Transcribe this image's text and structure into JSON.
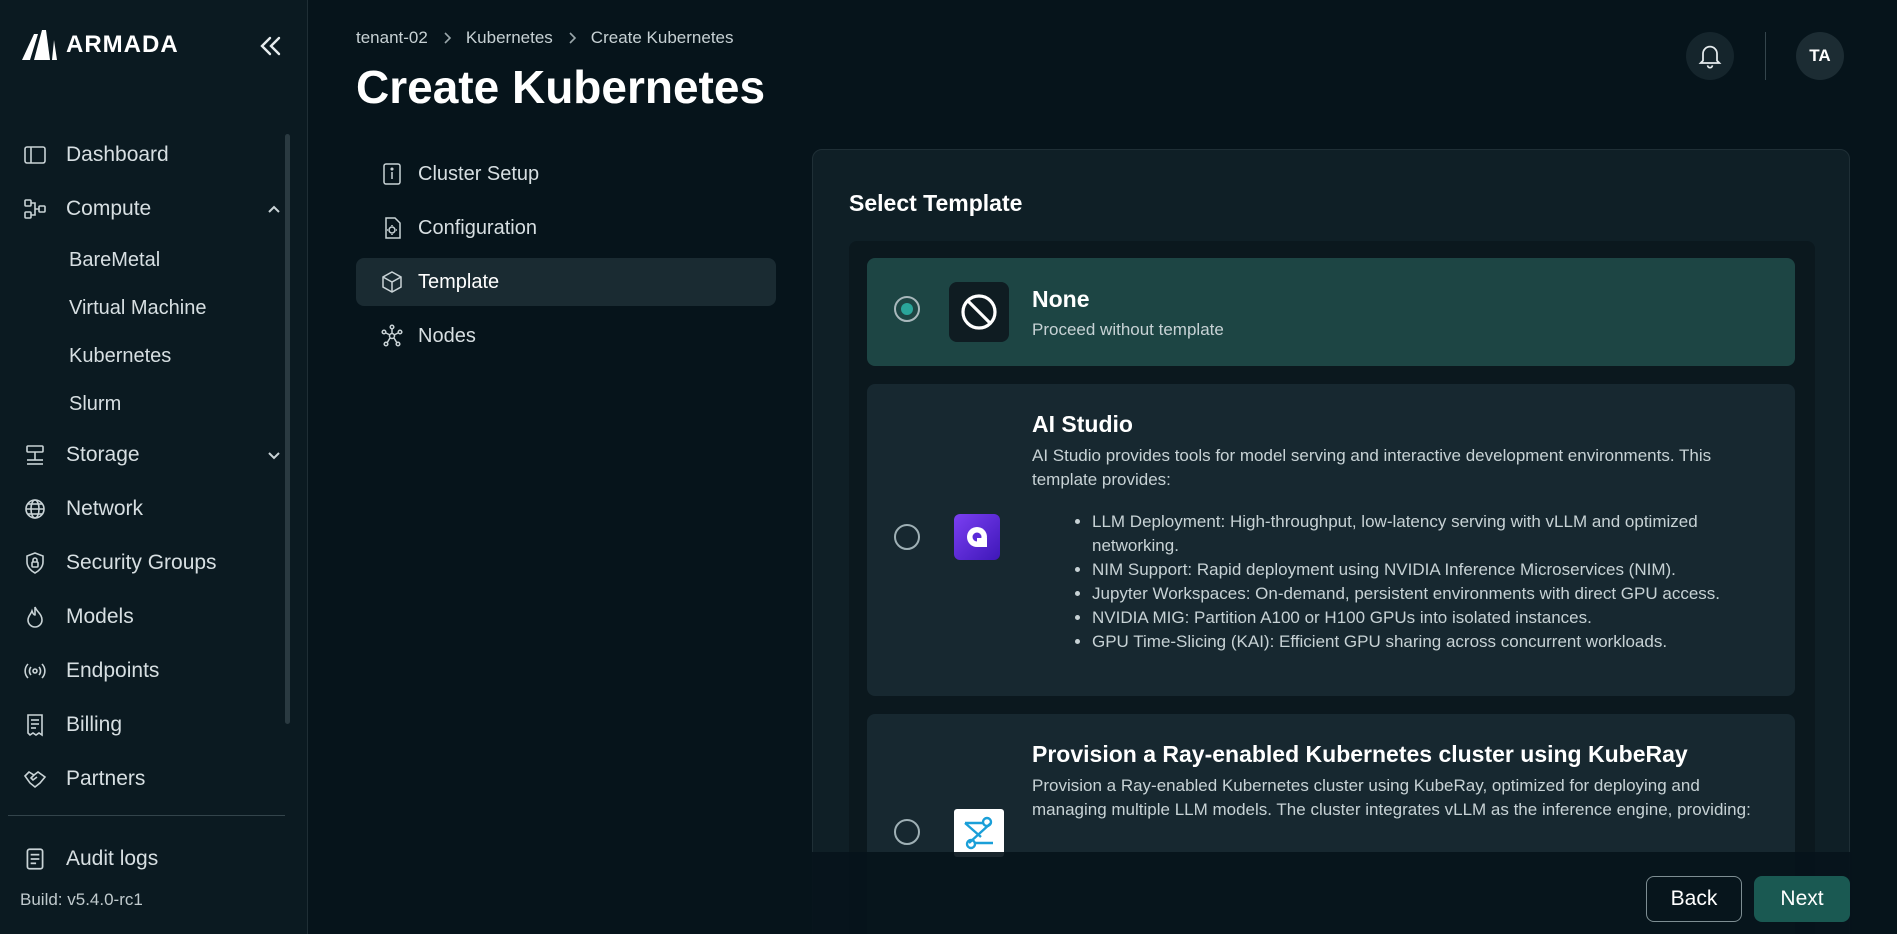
{
  "app": {
    "brand": "ARMADA",
    "build": "Build: v5.4.0-rc1"
  },
  "sidebar": {
    "items": [
      {
        "label": "Dashboard",
        "icon": "dashboard-icon"
      },
      {
        "label": "Compute",
        "icon": "compute-icon",
        "expanded": true
      },
      {
        "label": "Storage",
        "icon": "storage-icon",
        "expanded": false
      },
      {
        "label": "Network",
        "icon": "globe-icon"
      },
      {
        "label": "Security Groups",
        "icon": "shield-icon"
      },
      {
        "label": "Models",
        "icon": "flame-icon"
      },
      {
        "label": "Endpoints",
        "icon": "broadcast-icon"
      },
      {
        "label": "Billing",
        "icon": "receipt-icon"
      },
      {
        "label": "Partners",
        "icon": "handshake-icon"
      }
    ],
    "compute_sub": [
      "BareMetal",
      "Virtual Machine",
      "Kubernetes",
      "Slurm"
    ],
    "audit": "Audit logs"
  },
  "breadcrumb": [
    "tenant-02",
    "Kubernetes",
    "Create Kubernetes"
  ],
  "page": {
    "title": "Create Kubernetes"
  },
  "header": {
    "avatar": "TA"
  },
  "steps": [
    {
      "label": "Cluster Setup",
      "icon": "info-doc-icon"
    },
    {
      "label": "Configuration",
      "icon": "config-doc-icon"
    },
    {
      "label": "Template",
      "icon": "cube-icon",
      "active": true
    },
    {
      "label": "Nodes",
      "icon": "nodes-icon"
    }
  ],
  "template_section": {
    "title": "Select Template",
    "templates": [
      {
        "name": "None",
        "desc": "Proceed without template",
        "selected": true
      },
      {
        "name": "AI Studio",
        "desc": "AI Studio provides tools for model serving and interactive development environments. This template provides:",
        "bullets": [
          "LLM Deployment: High-throughput, low-latency serving with vLLM and optimized networking.",
          "NIM Support: Rapid deployment using NVIDIA Inference Microservices (NIM).",
          "Jupyter Workspaces: On-demand, persistent environments with direct GPU access.",
          "NVIDIA MIG: Partition A100 or H100 GPUs into isolated instances.",
          "GPU Time-Slicing (KAI): Efficient GPU sharing across concurrent workloads."
        ],
        "selected": false
      },
      {
        "name": "Provision a Ray-enabled Kubernetes cluster using KubeRay",
        "desc": "Provision a Ray-enabled Kubernetes cluster using KubeRay, optimized for deploying and managing multiple LLM models. The cluster integrates vLLM as the inference engine, providing:",
        "selected": false
      }
    ]
  },
  "footer": {
    "back": "Back",
    "next": "Next"
  },
  "colors": {
    "accent": "#1a5952",
    "selected_bg": "#1d4544",
    "bg": "#06141b"
  }
}
